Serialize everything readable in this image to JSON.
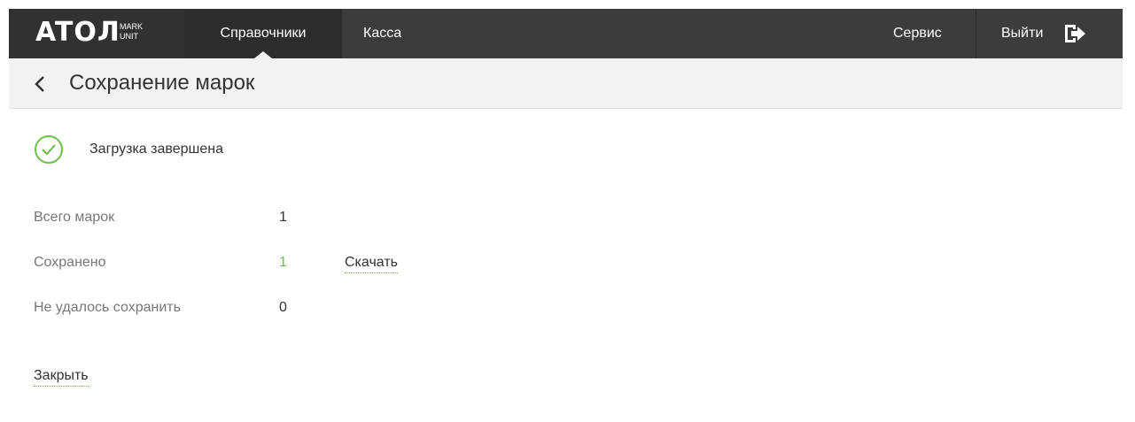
{
  "nav": {
    "logo_main": "ATOЛ",
    "logo_sub_1": "MARK",
    "logo_sub_2": "UNIT",
    "items": [
      "Справочники",
      "Касса"
    ],
    "service": "Сервис",
    "logout": "Выйти"
  },
  "header": {
    "title": "Сохранение марок"
  },
  "status": {
    "text": "Загрузка завершена",
    "icon": "check-circle-icon",
    "color": "#6cc04a"
  },
  "stats": [
    {
      "label": "Всего марок",
      "value": "1"
    },
    {
      "label": "Сохранено",
      "value": "1"
    },
    {
      "label": "Не удалось сохранить",
      "value": "0"
    }
  ],
  "actions": {
    "download": "Скачать",
    "close": "Закрыть"
  },
  "colors": {
    "nav_bg": "#3a3c3e",
    "accent": "#6cc04a"
  }
}
